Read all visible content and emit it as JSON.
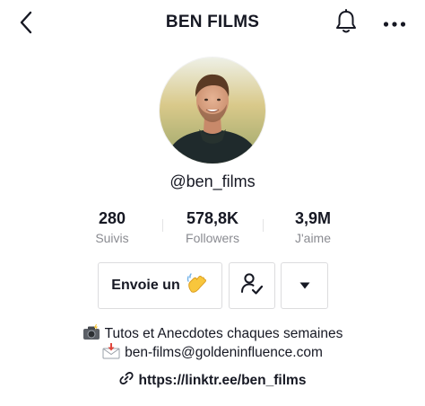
{
  "header": {
    "title": "BEN FILMS",
    "back_icon": "chevron-left-icon",
    "bell_icon": "bell-icon",
    "more_icon": "more-horizontal-icon"
  },
  "profile": {
    "username": "@ben_films"
  },
  "stats": [
    {
      "value": "280",
      "label": "Suivis"
    },
    {
      "value": "578,8K",
      "label": "Followers"
    },
    {
      "value": "3,9M",
      "label": "J'aime"
    }
  ],
  "actions": {
    "message_label": "Envoie un",
    "message_emoji_icon": "waving-hand-icon",
    "following_icon": "user-check-icon",
    "dropdown_icon": "caret-down-icon"
  },
  "bio": {
    "line1": "Tutos et Anecdotes chaques semaines",
    "line1_icon": "camera-flash-icon",
    "line2": "ben-films@goldeninfluence.com",
    "line2_icon": "envelope-arrow-icon",
    "link": "https://linktr.ee/ben_films",
    "link_icon": "link-icon"
  },
  "colors": {
    "text": "#161823",
    "muted": "#8a8b91",
    "border": "#dcdcde"
  }
}
